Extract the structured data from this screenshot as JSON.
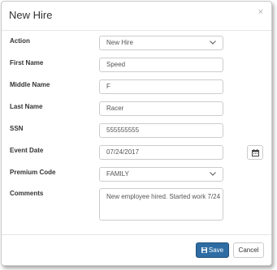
{
  "modal": {
    "title": "New Hire",
    "close_glyph": "×"
  },
  "fields": {
    "action": {
      "label": "Action",
      "value": "New Hire"
    },
    "first_name": {
      "label": "First Name",
      "value": "Speed"
    },
    "middle_name": {
      "label": "Middle Name",
      "value": "F"
    },
    "last_name": {
      "label": "Last Name",
      "value": "Racer"
    },
    "ssn": {
      "label": "SSN",
      "value": "555555555"
    },
    "event_date": {
      "label": "Event Date",
      "value": "07/24/2017"
    },
    "premium_code": {
      "label": "Premium Code",
      "value": "FAMILY"
    },
    "comments": {
      "label": "Comments",
      "value": "New employee hired.  Started work 7/24"
    }
  },
  "footer": {
    "save_label": "Save",
    "cancel_label": "Cancel"
  },
  "icons": {
    "calendar": "calendar-icon",
    "save": "floppy-disk-icon",
    "chevron": "chevron-down-icon"
  },
  "colors": {
    "primary": "#2e6da4",
    "border": "#cccccc"
  }
}
